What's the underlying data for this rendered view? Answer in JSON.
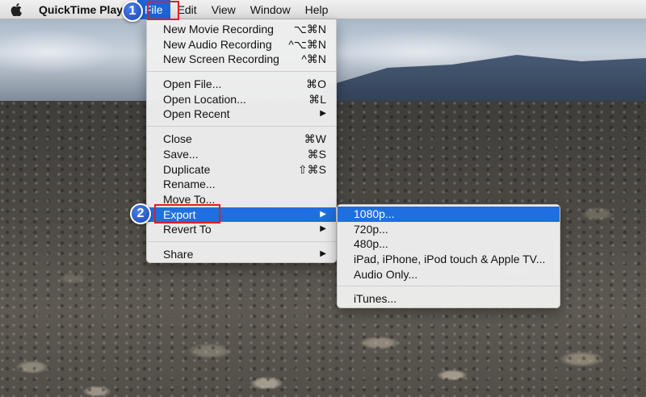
{
  "menubar": {
    "app_name": "QuickTime Player",
    "menus": [
      "File",
      "Edit",
      "View",
      "Window",
      "Help"
    ]
  },
  "file_menu": {
    "items": [
      {
        "label": "New Movie Recording",
        "shortcut": "⌥⌘N"
      },
      {
        "label": "New Audio Recording",
        "shortcut": "^⌥⌘N"
      },
      {
        "label": "New Screen Recording",
        "shortcut": "^⌘N"
      },
      {
        "label": "Open File...",
        "shortcut": "⌘O"
      },
      {
        "label": "Open Location...",
        "shortcut": "⌘L"
      },
      {
        "label": "Open Recent",
        "submenu": "▶"
      },
      {
        "label": "Close",
        "shortcut": "⌘W"
      },
      {
        "label": "Save...",
        "shortcut": "⌘S"
      },
      {
        "label": "Duplicate",
        "shortcut": "⇧⌘S"
      },
      {
        "label": "Rename..."
      },
      {
        "label": "Move To..."
      },
      {
        "label": "Export",
        "submenu": "▶"
      },
      {
        "label": "Revert To",
        "submenu": "▶"
      },
      {
        "label": "Share",
        "submenu": "▶"
      }
    ]
  },
  "export_submenu": {
    "items": [
      "1080p...",
      "720p...",
      "480p...",
      "iPad, iPhone, iPod touch & Apple TV...",
      "Audio Only...",
      "iTunes..."
    ]
  },
  "callouts": {
    "step1": "1",
    "step2": "2"
  },
  "colors": {
    "highlight": "#1f6fe0",
    "callout_border": "#e02020",
    "badge": "#1b45b8"
  }
}
